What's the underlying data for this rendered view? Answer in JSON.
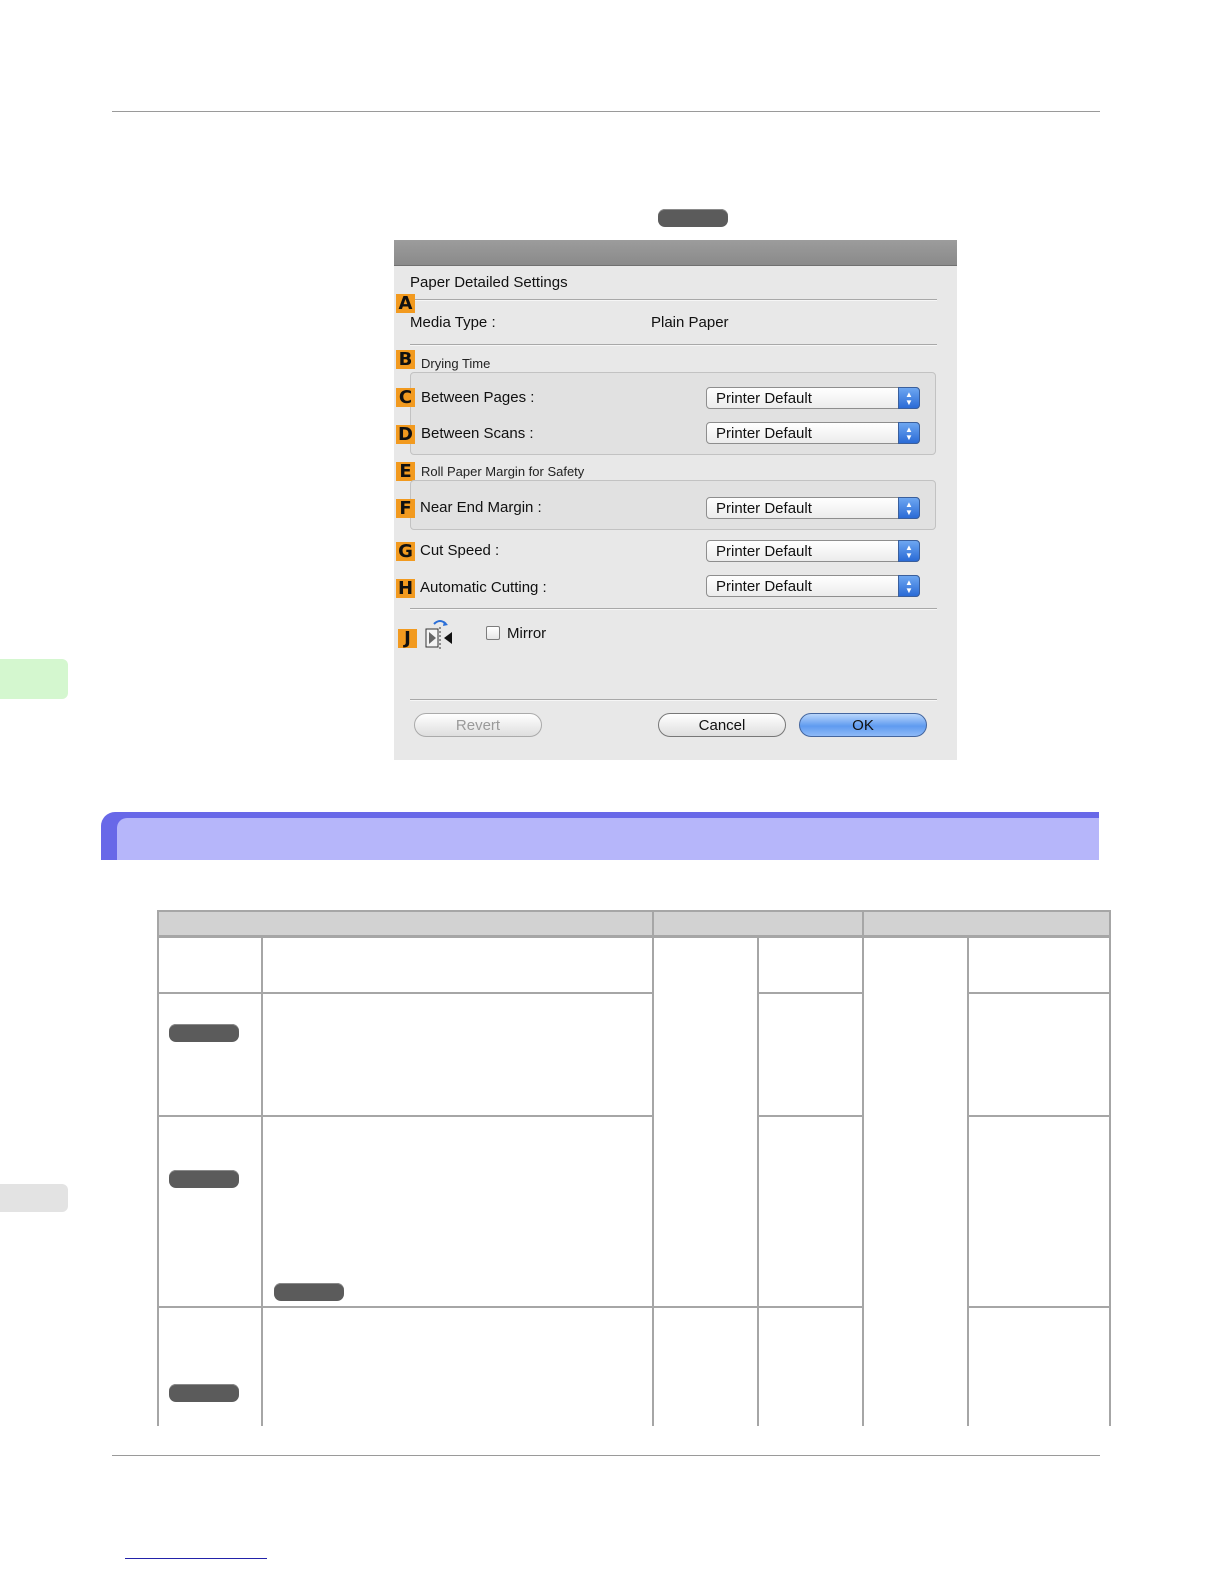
{
  "dialog": {
    "title": "Paper Detailed Settings",
    "media_type_label": "Media Type :",
    "media_type_value": "Plain Paper",
    "drying_time_group": "Drying Time",
    "roll_margin_group": "Roll Paper Margin for Safety",
    "rows": [
      {
        "badge": "C",
        "label": "Between Pages :",
        "value": "Printer Default"
      },
      {
        "badge": "D",
        "label": "Between Scans :",
        "value": "Printer Default"
      },
      {
        "badge": "F",
        "label": "Near End Margin :",
        "value": "Printer Default"
      },
      {
        "badge": "G",
        "label": "Cut Speed :",
        "value": "Printer Default"
      },
      {
        "badge": "H",
        "label": "Automatic Cutting :",
        "value": "Printer Default"
      }
    ],
    "badges": {
      "a": "A",
      "b": "B",
      "e": "E",
      "j": "J"
    },
    "mirror_label": "Mirror",
    "mirror_checked": false,
    "buttons": {
      "revert": "Revert",
      "cancel": "Cancel",
      "ok": "OK"
    }
  },
  "colors": {
    "badge": "#f29a1f",
    "section_header_dark": "#6868e8",
    "section_header_light": "#b6b6fa",
    "side_tab_green": "#d4f7cf",
    "side_tab_grey": "#e3e3e3",
    "pill": "#5b5b5b"
  }
}
